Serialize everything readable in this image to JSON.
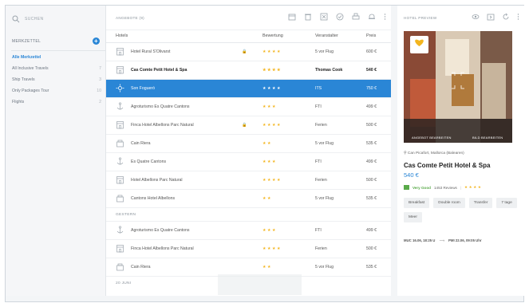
{
  "search": {
    "placeholder": "SUCHEN"
  },
  "sidebar": {
    "header": "MERKZETTEL",
    "items": [
      {
        "label": "Alle Merkzettel",
        "a": "",
        "b": "",
        "active": true
      },
      {
        "label": "All Inclusive Travels",
        "a": "",
        "b": "7",
        "active": false
      },
      {
        "label": "Ship Travels",
        "a": "",
        "b": "3",
        "active": false
      },
      {
        "label": "Only Packages Tour",
        "a": "",
        "b": "10",
        "active": false
      },
      {
        "label": "Flights",
        "a": "",
        "b": "2",
        "active": false
      }
    ]
  },
  "main": {
    "title": "ANGEBOTE (9)",
    "columns": {
      "hotels": "Hotels",
      "rating": "Bewertung",
      "operator": "Veranstalter",
      "price": "Preis"
    },
    "rows": [
      {
        "name": "Hotel Rural S'Olivarst",
        "stars": "★★★★",
        "operator": "5 vor Flug",
        "price": "600 €",
        "style": "normal",
        "icon": "building",
        "lock": true
      },
      {
        "name": "Cas Comte Petit Hotel & Spa",
        "stars": "★★★★",
        "operator": "Thomas Cook",
        "price": "540 €",
        "style": "bold",
        "icon": "building",
        "lock": false
      },
      {
        "name": "Son Fogueró",
        "stars": "★★★★",
        "operator": "ITS",
        "price": "750 €",
        "style": "sel",
        "icon": "sun",
        "lock": false
      },
      {
        "name": "Agroturismo Es Quatre Cantons",
        "stars": "★★★",
        "operator": "FTI",
        "price": "499 €",
        "style": "normal",
        "icon": "anchor",
        "lock": false
      },
      {
        "name": "Finca Hotel Albellons Parc Natural",
        "stars": "★★★★",
        "operator": "Ferien",
        "price": "500 €",
        "style": "normal",
        "icon": "building",
        "lock": true
      },
      {
        "name": "Cain Riera",
        "stars": "★★",
        "operator": "5 vor Flug",
        "price": "535 €",
        "style": "normal",
        "icon": "house",
        "lock": false
      },
      {
        "name": "Es Quatre Cantons",
        "stars": "★★★",
        "operator": "FTI",
        "price": "499 €",
        "style": "normal",
        "icon": "anchor",
        "lock": false
      },
      {
        "name": "Hotel Albellons Parc Natural",
        "stars": "★★★★",
        "operator": "Ferien",
        "price": "500 €",
        "style": "normal",
        "icon": "building",
        "lock": false
      },
      {
        "name": "Cantons Hotel Albellons",
        "stars": "★★",
        "operator": "5 vor Flug",
        "price": "535 €",
        "style": "normal",
        "icon": "house",
        "lock": false
      }
    ],
    "group_gestern": "GESTERN",
    "rows2": [
      {
        "name": "Agroturismo Es Quatre Cantons",
        "stars": "★★★",
        "operator": "FTI",
        "price": "499 €",
        "style": "normal",
        "icon": "anchor",
        "lock": false
      },
      {
        "name": "Finca Hotel Albellons Parc Natural",
        "stars": "★★★★",
        "operator": "Ferien",
        "price": "500 €",
        "style": "normal",
        "icon": "building",
        "lock": false
      },
      {
        "name": "Cain Riera",
        "stars": "★★",
        "operator": "5 vor Flug",
        "price": "535 €",
        "style": "normal",
        "icon": "house",
        "lock": false
      }
    ],
    "group_juni": "20 JUNI"
  },
  "preview": {
    "title": "HOTEL PREVIEW",
    "btn_offer": "ANGEBOT BEARBEITEN",
    "btn_image": "BILD BEARBEITEN",
    "location": "Can Picafort, Mallorca (Balearen)",
    "name": "Cas Comte Petit Hotel & Spa",
    "price": "540 €",
    "rating_label": "Very Good",
    "reviews": "1453 Reviews",
    "stars": "★★★★",
    "tags": [
      "Breakfast",
      "Double room",
      "Transfer",
      "7 tage",
      "Meer"
    ],
    "flight_out": "MUC 16.06, 18:25 U",
    "flight_back": "PMI 22.06, 09:05 Uhr"
  },
  "colors": {
    "accent": "#2a86d6",
    "star": "#f3b51f",
    "good": "#5aaa4a"
  }
}
